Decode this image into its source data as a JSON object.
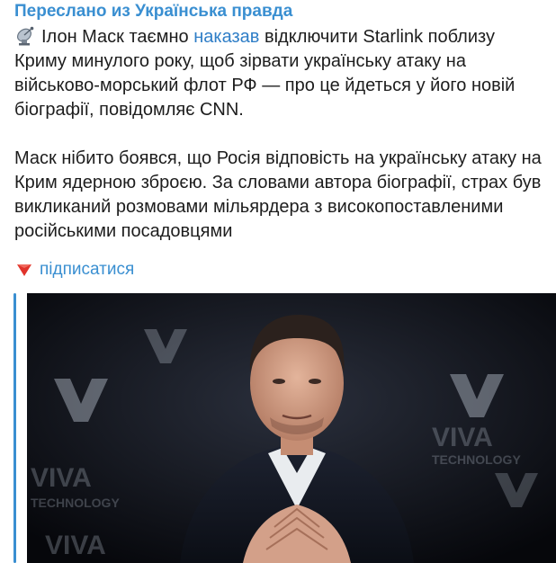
{
  "header": {
    "forward_label": "Переслано из Українська правда"
  },
  "message": {
    "icon": "satellite-antenna-icon",
    "para1_before_link": "Ілон Маск таємно ",
    "para1_link": "наказав",
    "para1_after_link": " відключити Starlink поблизу Криму минулого року, щоб зірвати українську атаку на військово-морський флот РФ — про це йдеться у його новій біографії, повідомляє CNN.",
    "para2": "Маск нібито боявся, що Росія відповість на українську атаку на Крим ядерною зброєю. За словами автора біографії, страх був викликаний розмовами мільярдера з високопоставленими російськими посадовцями"
  },
  "subscribe": {
    "icon": "red-triangle-down-icon",
    "label": "підписатися"
  },
  "photo": {
    "bg_text_1": "VIVA",
    "bg_text_2": "TECHNOLOGY",
    "accent": "#3a8fd1"
  }
}
